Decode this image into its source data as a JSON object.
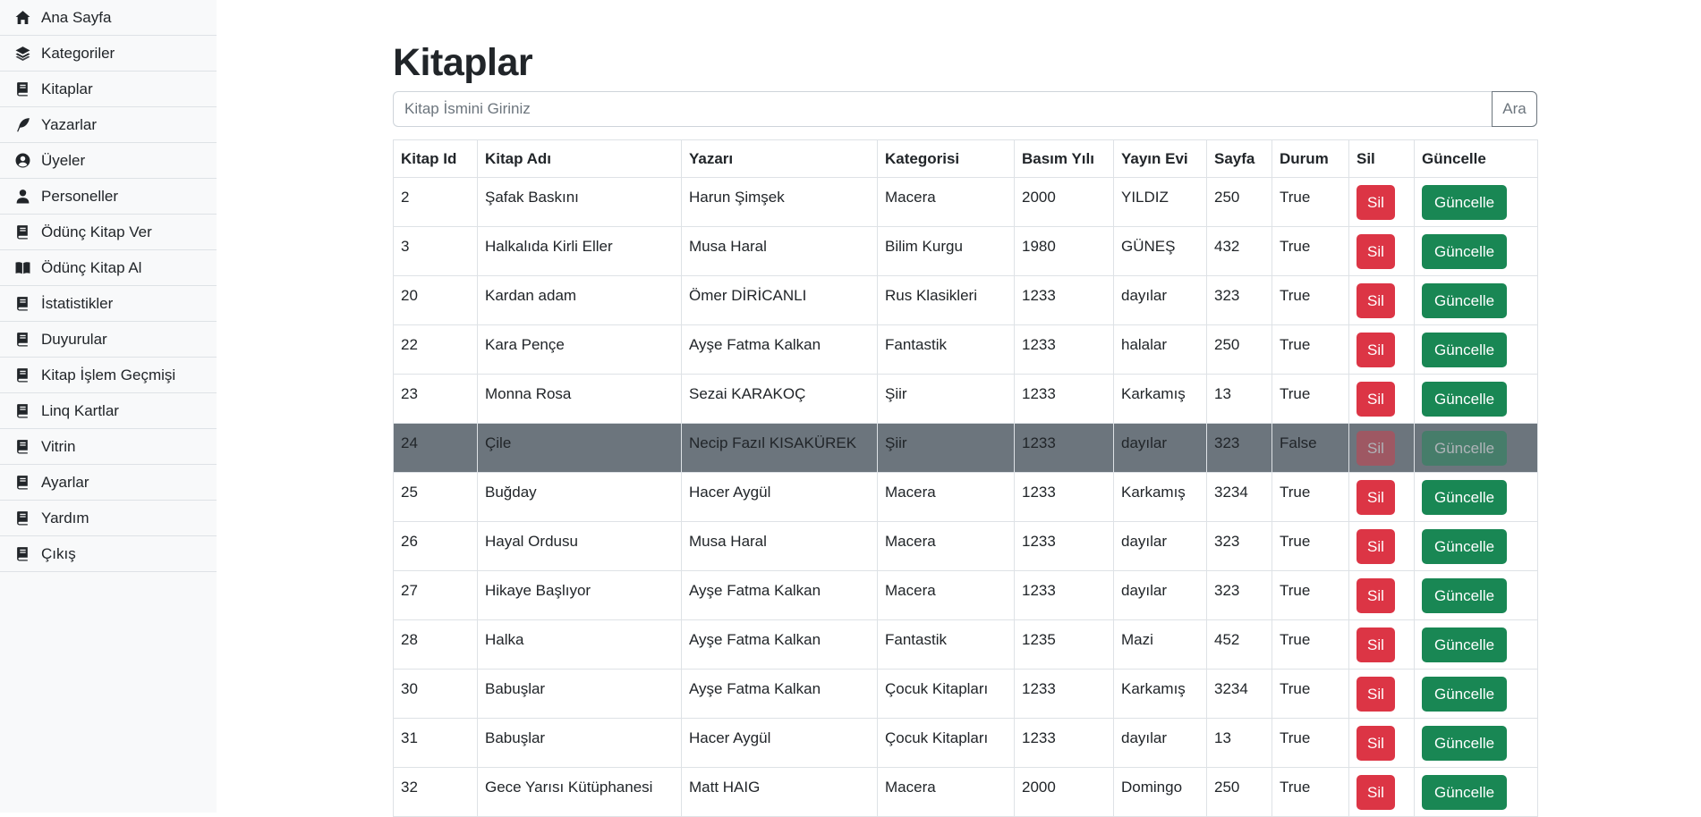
{
  "sidebar": {
    "items": [
      {
        "label": "Ana Sayfa",
        "icon": "home-icon"
      },
      {
        "label": "Kategoriler",
        "icon": "layers-icon"
      },
      {
        "label": "Kitaplar",
        "icon": "book-icon"
      },
      {
        "label": "Yazarlar",
        "icon": "feather-icon"
      },
      {
        "label": "Üyeler",
        "icon": "user-circle-icon"
      },
      {
        "label": "Personeller",
        "icon": "user-icon"
      },
      {
        "label": "Ödünç Kitap Ver",
        "icon": "book-icon"
      },
      {
        "label": "Ödünç Kitap Al",
        "icon": "book-open-icon"
      },
      {
        "label": "İstatistikler",
        "icon": "book-icon"
      },
      {
        "label": "Duyurular",
        "icon": "book-icon"
      },
      {
        "label": "Kitap İşlem Geçmişi",
        "icon": "book-icon"
      },
      {
        "label": "Linq Kartlar",
        "icon": "book-icon"
      },
      {
        "label": "Vitrin",
        "icon": "book-icon"
      },
      {
        "label": "Ayarlar",
        "icon": "book-icon"
      },
      {
        "label": "Yardım",
        "icon": "book-icon"
      },
      {
        "label": "Çıkış",
        "icon": "book-icon"
      }
    ]
  },
  "main": {
    "title": "Kitaplar",
    "search": {
      "placeholder": "Kitap İsmini Giriniz",
      "value": "",
      "button_label": "Ara"
    }
  },
  "table": {
    "columns": [
      "Kitap Id",
      "Kitap Adı",
      "Yazarı",
      "Kategorisi",
      "Basım Yılı",
      "Yayın Evi",
      "Sayfa",
      "Durum",
      "Sil",
      "Güncelle"
    ],
    "delete_label": "Sil",
    "update_label": "Güncelle",
    "selected_row_id": "24",
    "rows": [
      [
        "2",
        "Şafak Baskını",
        "Harun Şimşek",
        "Macera",
        "2000",
        "YILDIZ",
        "250",
        "True"
      ],
      [
        "3",
        "Halkalıda Kirli Eller",
        "Musa Haral",
        "Bilim Kurgu",
        "1980",
        "GÜNEŞ",
        "432",
        "True"
      ],
      [
        "20",
        "Kardan adam",
        "Ömer DİRİCANLI",
        "Rus Klasikleri",
        "1233",
        "dayılar",
        "323",
        "True"
      ],
      [
        "22",
        "Kara Pençe",
        "Ayşe Fatma Kalkan",
        "Fantastik",
        "1233",
        "halalar",
        "250",
        "True"
      ],
      [
        "23",
        "Monna Rosa",
        "Sezai KARAKOÇ",
        "Şiir",
        "1233",
        "Karkamış",
        "13",
        "True"
      ],
      [
        "24",
        "Çile",
        "Necip Fazıl KISAKÜREK",
        "Şiir",
        "1233",
        "dayılar",
        "323",
        "False"
      ],
      [
        "25",
        "Buğday",
        "Hacer Aygül",
        "Macera",
        "1233",
        "Karkamış",
        "3234",
        "True"
      ],
      [
        "26",
        "Hayal Ordusu",
        "Musa Haral",
        "Macera",
        "1233",
        "dayılar",
        "323",
        "True"
      ],
      [
        "27",
        "Hikaye Başlıyor",
        "Ayşe Fatma Kalkan",
        "Macera",
        "1233",
        "dayılar",
        "323",
        "True"
      ],
      [
        "28",
        "Halka",
        "Ayşe Fatma Kalkan",
        "Fantastik",
        "1235",
        "Mazi",
        "452",
        "True"
      ],
      [
        "30",
        "Babuşlar",
        "Ayşe Fatma Kalkan",
        "Çocuk Kitapları",
        "1233",
        "Karkamış",
        "3234",
        "True"
      ],
      [
        "31",
        "Babuşlar",
        "Hacer Aygül",
        "Çocuk Kitapları",
        "1233",
        "dayılar",
        "13",
        "True"
      ],
      [
        "32",
        "Gece Yarısı Kütüphanesi",
        "Matt HAIG",
        "Macera",
        "2000",
        "Domingo",
        "250",
        "True"
      ]
    ]
  },
  "colors": {
    "danger": "#dc3545",
    "success": "#198754",
    "selected_row": "#6c757d",
    "sidebar_bg": "#f8f9fa"
  }
}
